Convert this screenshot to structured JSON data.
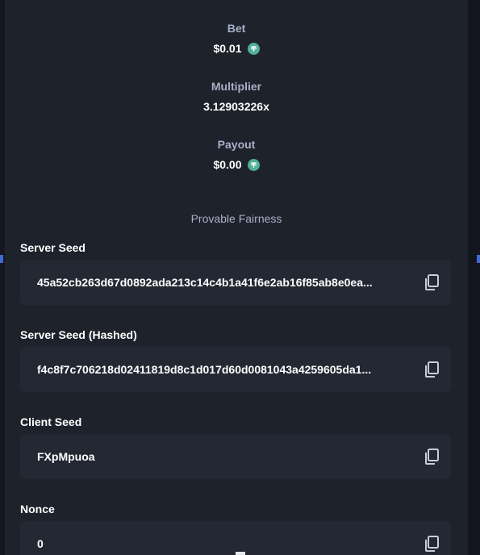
{
  "bet": {
    "label": "Bet",
    "value": "$0.01",
    "currency_icon": "tether-coin-icon"
  },
  "multiplier": {
    "label": "Multiplier",
    "value": "3.12903226x"
  },
  "payout": {
    "label": "Payout",
    "value": "$0.00",
    "currency_icon": "tether-coin-icon"
  },
  "fairness": {
    "title": "Provable Fairness",
    "fields": [
      {
        "label": "Server Seed",
        "value": "45a52cb263d67d0892ada213c14c4b1a41f6e2ab16f85ab8e0ea..."
      },
      {
        "label": "Server Seed (Hashed)",
        "value": "f4c8f7c706218d02411819d8c1d017d60d0081043a4259605da1..."
      },
      {
        "label": "Client Seed",
        "value": "FXpMpuoa"
      },
      {
        "label": "Nonce",
        "value": "0"
      }
    ],
    "copy_icon": "copy-icon"
  },
  "colors": {
    "background": "#1e222b",
    "field_background": "#232833",
    "label": "#a7b0c7",
    "text": "#ffffff",
    "coin": "#50af95"
  }
}
